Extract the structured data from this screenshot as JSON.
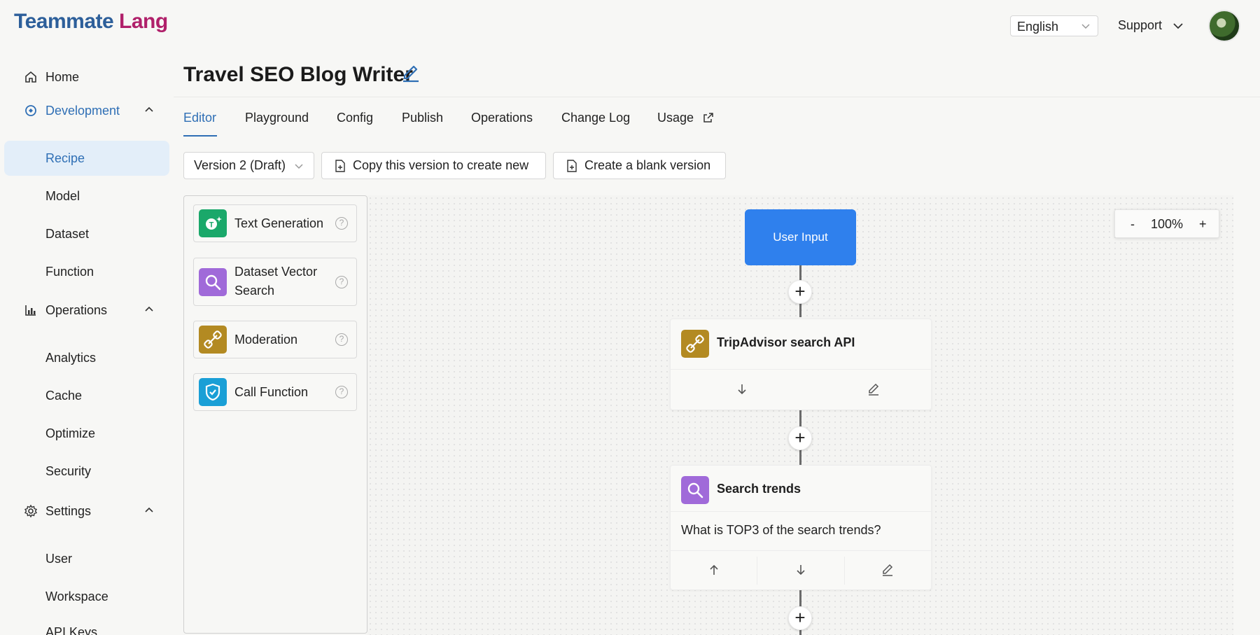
{
  "header": {
    "logo_part1": "Teammate",
    "logo_part2": "Lang",
    "language": "English",
    "support": "Support"
  },
  "sidebar": {
    "home": "Home",
    "development": "Development",
    "development_items": [
      "Recipe",
      "Model",
      "Dataset",
      "Function"
    ],
    "operations": "Operations",
    "operations_items": [
      "Analytics",
      "Cache",
      "Optimize",
      "Security"
    ],
    "settings": "Settings",
    "settings_items": [
      "User",
      "Workspace",
      "API Keys"
    ]
  },
  "page": {
    "title": "Travel SEO Blog Writer",
    "tabs": [
      "Editor",
      "Playground",
      "Config",
      "Publish",
      "Operations",
      "Change Log",
      "Usage"
    ]
  },
  "toolbar": {
    "version": "Version 2 (Draft)",
    "copy_label": "Copy this version to create new",
    "blank_label": "Create a blank version"
  },
  "palette": {
    "items": [
      {
        "label": "Text Generation",
        "color": "#1aa86a"
      },
      {
        "label": "Dataset Vector Search",
        "color": "#a06ad9"
      },
      {
        "label": "Moderation",
        "color": "#b38a22"
      },
      {
        "label": "Call Function",
        "color": "#1a9fd6"
      }
    ],
    "help_glyph": "?"
  },
  "canvas": {
    "zoom_out": "-",
    "zoom_level": "100%",
    "zoom_in": "+",
    "user_input": "User Input",
    "plus": "+",
    "cards": [
      {
        "title": "TripAdvisor search API",
        "color": "#b38a22"
      },
      {
        "title": "Search trends",
        "body": "What is TOP3 of the search trends?",
        "color": "#a06ad9"
      }
    ]
  },
  "colors": {
    "accent": "#2f6fb5",
    "user_input_bg": "#2f80ed"
  }
}
